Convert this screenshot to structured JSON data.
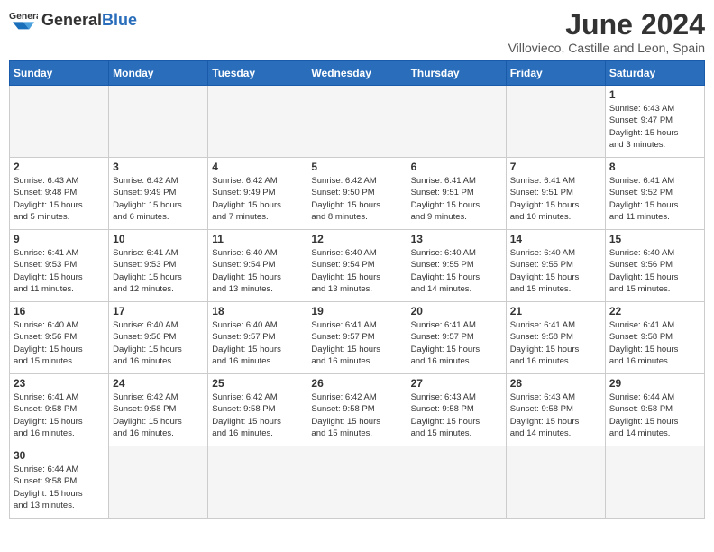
{
  "header": {
    "logo_text_normal": "General",
    "logo_text_bold": "Blue",
    "title": "June 2024",
    "subtitle": "Villovieco, Castille and Leon, Spain"
  },
  "weekdays": [
    "Sunday",
    "Monday",
    "Tuesday",
    "Wednesday",
    "Thursday",
    "Friday",
    "Saturday"
  ],
  "weeks": [
    [
      {
        "day": "",
        "info": ""
      },
      {
        "day": "",
        "info": ""
      },
      {
        "day": "",
        "info": ""
      },
      {
        "day": "",
        "info": ""
      },
      {
        "day": "",
        "info": ""
      },
      {
        "day": "",
        "info": ""
      },
      {
        "day": "1",
        "info": "Sunrise: 6:43 AM\nSunset: 9:47 PM\nDaylight: 15 hours\nand 3 minutes."
      }
    ],
    [
      {
        "day": "2",
        "info": "Sunrise: 6:43 AM\nSunset: 9:48 PM\nDaylight: 15 hours\nand 5 minutes."
      },
      {
        "day": "3",
        "info": "Sunrise: 6:42 AM\nSunset: 9:49 PM\nDaylight: 15 hours\nand 6 minutes."
      },
      {
        "day": "4",
        "info": "Sunrise: 6:42 AM\nSunset: 9:49 PM\nDaylight: 15 hours\nand 7 minutes."
      },
      {
        "day": "5",
        "info": "Sunrise: 6:42 AM\nSunset: 9:50 PM\nDaylight: 15 hours\nand 8 minutes."
      },
      {
        "day": "6",
        "info": "Sunrise: 6:41 AM\nSunset: 9:51 PM\nDaylight: 15 hours\nand 9 minutes."
      },
      {
        "day": "7",
        "info": "Sunrise: 6:41 AM\nSunset: 9:51 PM\nDaylight: 15 hours\nand 10 minutes."
      },
      {
        "day": "8",
        "info": "Sunrise: 6:41 AM\nSunset: 9:52 PM\nDaylight: 15 hours\nand 11 minutes."
      }
    ],
    [
      {
        "day": "9",
        "info": "Sunrise: 6:41 AM\nSunset: 9:53 PM\nDaylight: 15 hours\nand 11 minutes."
      },
      {
        "day": "10",
        "info": "Sunrise: 6:41 AM\nSunset: 9:53 PM\nDaylight: 15 hours\nand 12 minutes."
      },
      {
        "day": "11",
        "info": "Sunrise: 6:40 AM\nSunset: 9:54 PM\nDaylight: 15 hours\nand 13 minutes."
      },
      {
        "day": "12",
        "info": "Sunrise: 6:40 AM\nSunset: 9:54 PM\nDaylight: 15 hours\nand 13 minutes."
      },
      {
        "day": "13",
        "info": "Sunrise: 6:40 AM\nSunset: 9:55 PM\nDaylight: 15 hours\nand 14 minutes."
      },
      {
        "day": "14",
        "info": "Sunrise: 6:40 AM\nSunset: 9:55 PM\nDaylight: 15 hours\nand 15 minutes."
      },
      {
        "day": "15",
        "info": "Sunrise: 6:40 AM\nSunset: 9:56 PM\nDaylight: 15 hours\nand 15 minutes."
      }
    ],
    [
      {
        "day": "16",
        "info": "Sunrise: 6:40 AM\nSunset: 9:56 PM\nDaylight: 15 hours\nand 15 minutes."
      },
      {
        "day": "17",
        "info": "Sunrise: 6:40 AM\nSunset: 9:56 PM\nDaylight: 15 hours\nand 16 minutes."
      },
      {
        "day": "18",
        "info": "Sunrise: 6:40 AM\nSunset: 9:57 PM\nDaylight: 15 hours\nand 16 minutes."
      },
      {
        "day": "19",
        "info": "Sunrise: 6:41 AM\nSunset: 9:57 PM\nDaylight: 15 hours\nand 16 minutes."
      },
      {
        "day": "20",
        "info": "Sunrise: 6:41 AM\nSunset: 9:57 PM\nDaylight: 15 hours\nand 16 minutes."
      },
      {
        "day": "21",
        "info": "Sunrise: 6:41 AM\nSunset: 9:58 PM\nDaylight: 15 hours\nand 16 minutes."
      },
      {
        "day": "22",
        "info": "Sunrise: 6:41 AM\nSunset: 9:58 PM\nDaylight: 15 hours\nand 16 minutes."
      }
    ],
    [
      {
        "day": "23",
        "info": "Sunrise: 6:41 AM\nSunset: 9:58 PM\nDaylight: 15 hours\nand 16 minutes."
      },
      {
        "day": "24",
        "info": "Sunrise: 6:42 AM\nSunset: 9:58 PM\nDaylight: 15 hours\nand 16 minutes."
      },
      {
        "day": "25",
        "info": "Sunrise: 6:42 AM\nSunset: 9:58 PM\nDaylight: 15 hours\nand 16 minutes."
      },
      {
        "day": "26",
        "info": "Sunrise: 6:42 AM\nSunset: 9:58 PM\nDaylight: 15 hours\nand 15 minutes."
      },
      {
        "day": "27",
        "info": "Sunrise: 6:43 AM\nSunset: 9:58 PM\nDaylight: 15 hours\nand 15 minutes."
      },
      {
        "day": "28",
        "info": "Sunrise: 6:43 AM\nSunset: 9:58 PM\nDaylight: 15 hours\nand 14 minutes."
      },
      {
        "day": "29",
        "info": "Sunrise: 6:44 AM\nSunset: 9:58 PM\nDaylight: 15 hours\nand 14 minutes."
      }
    ],
    [
      {
        "day": "30",
        "info": "Sunrise: 6:44 AM\nSunset: 9:58 PM\nDaylight: 15 hours\nand 13 minutes."
      },
      {
        "day": "",
        "info": ""
      },
      {
        "day": "",
        "info": ""
      },
      {
        "day": "",
        "info": ""
      },
      {
        "day": "",
        "info": ""
      },
      {
        "day": "",
        "info": ""
      },
      {
        "day": "",
        "info": ""
      }
    ]
  ]
}
